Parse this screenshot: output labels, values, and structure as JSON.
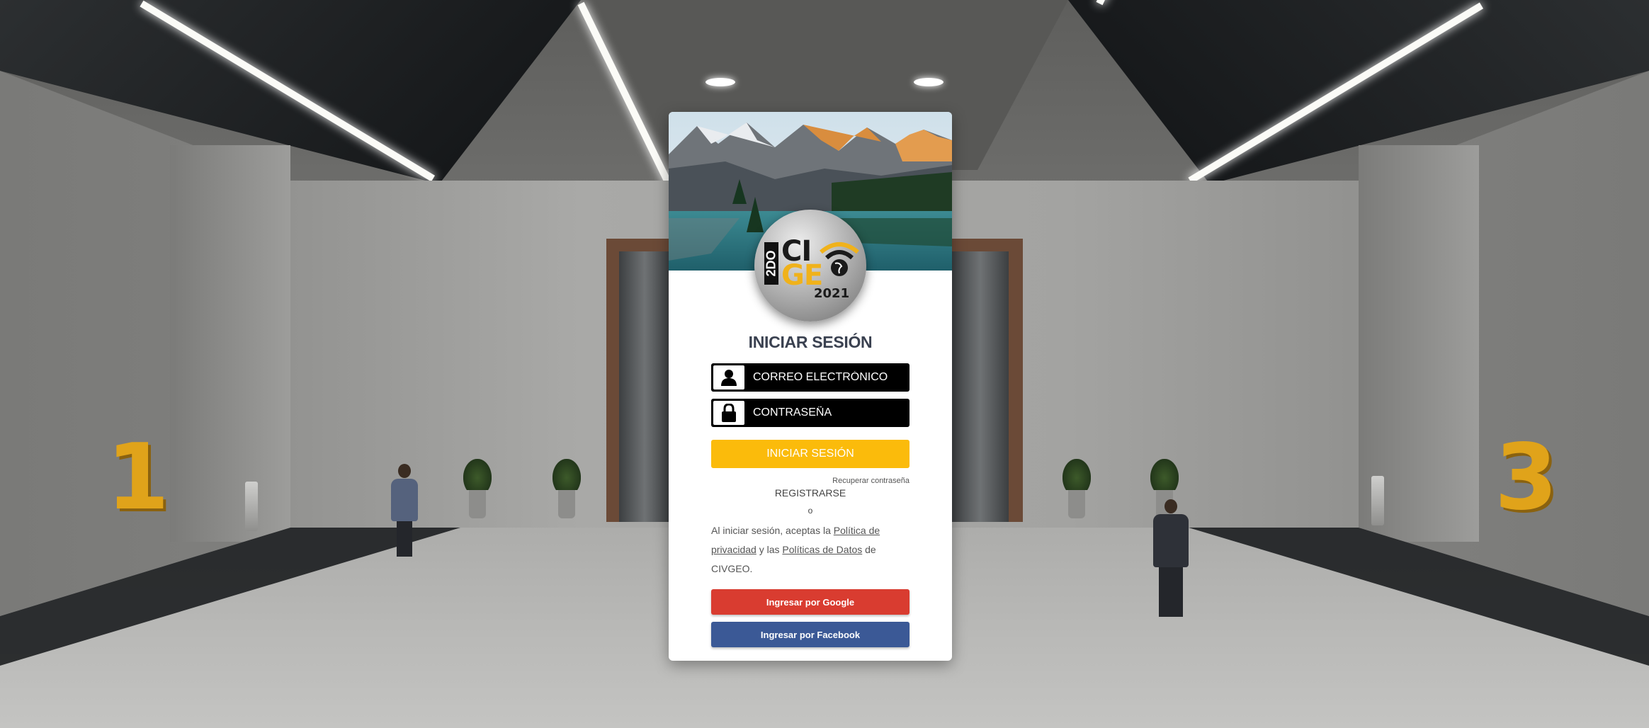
{
  "background": {
    "left_number": "1",
    "right_number": "3"
  },
  "logo": {
    "edition": "2DO",
    "line1": "CI",
    "line2": "GE",
    "year": "2021"
  },
  "login": {
    "title": "INICIAR SESIÓN",
    "email_placeholder": "CORREO ELECTRÓNICO",
    "password_placeholder": "CONTRASEÑA",
    "email_icon": "user-icon",
    "password_icon": "lock-icon",
    "submit_label": "INICIAR SESIÓN",
    "recover_label": "Recuperar contraseña",
    "register_label": "REGISTRARSE",
    "or_label": "o",
    "terms_prefix": "Al iniciar sesión, aceptas la ",
    "privacy_link": "Política de privacidad",
    "terms_middle": " y las ",
    "data_link": "Políticas de Datos",
    "terms_suffix": " de CIVGEO.",
    "google_label": "Ingresar por Google",
    "facebook_label": "Ingresar por Facebook"
  },
  "colors": {
    "accent_yellow": "#fbbb0b",
    "google_red": "#d93c30",
    "facebook_blue": "#3b5996",
    "field_black": "#000000"
  }
}
